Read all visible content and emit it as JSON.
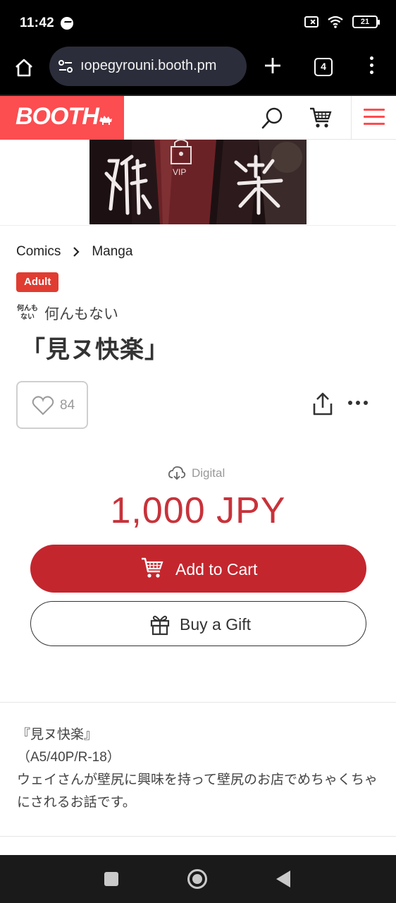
{
  "status_bar": {
    "time": "11:42",
    "battery": "21"
  },
  "browser": {
    "url": "ıopegyrouni.booth.pm",
    "tab_count": "4"
  },
  "header": {
    "logo": "BOOTH",
    "brand_color": "#fc4d50"
  },
  "breadcrumb": {
    "items": [
      "Comics",
      "Manga"
    ]
  },
  "product": {
    "badge": "Adult",
    "shop_avatar": "何んも ない",
    "shop_name": "何んもない",
    "title": "「見ヌ快楽」",
    "likes": "84",
    "delivery": "Digital",
    "price": "1,000 JPY",
    "price_color": "#c8323a"
  },
  "actions": {
    "add_to_cart": "Add to Cart",
    "buy_gift": "Buy a Gift"
  },
  "description": {
    "lines": [
      "『見ヌ快楽』",
      "（A5/40P/R-18）",
      "ウェイさんが壁尻に興味を持って壁尻のお店でめちゃくちゃにされるお話です。"
    ]
  },
  "icons": {
    "home": "home-icon",
    "site_settings": "tune-icon",
    "new_tab": "plus-icon",
    "search": "search-icon",
    "cart": "cart-icon",
    "menu": "hamburger-icon",
    "like": "heart-icon",
    "share": "share-icon",
    "more": "more-horizontal-icon",
    "digital": "cloud-download-icon",
    "gift": "gift-icon"
  }
}
